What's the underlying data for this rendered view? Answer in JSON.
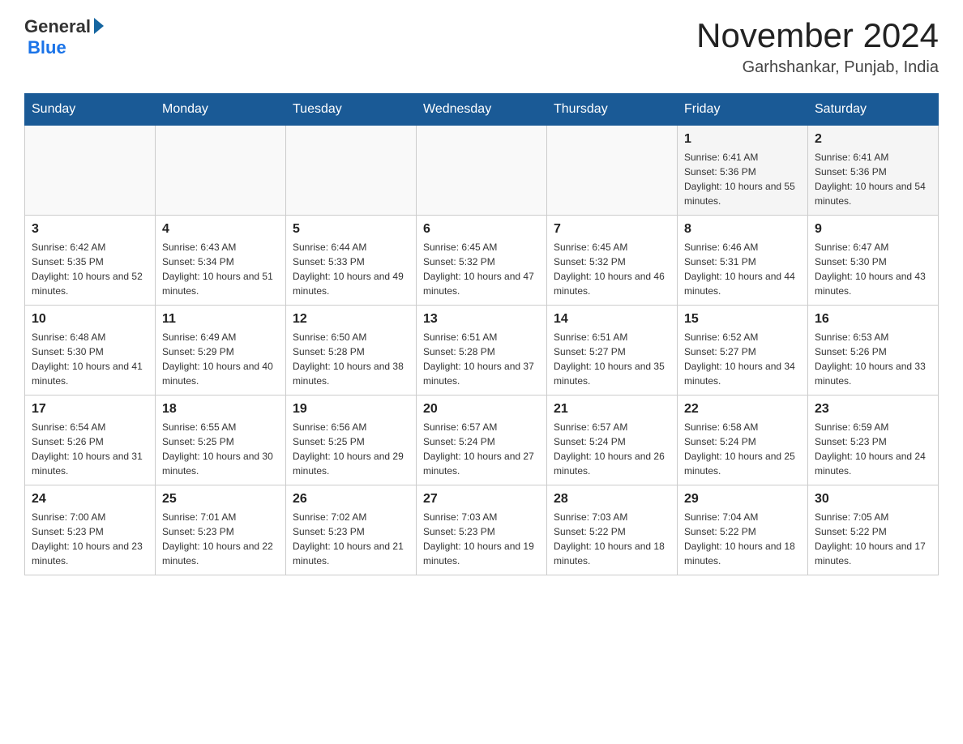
{
  "header": {
    "logo_text": "General",
    "logo_blue": "Blue",
    "main_title": "November 2024",
    "subtitle": "Garhshankar, Punjab, India"
  },
  "weekdays": [
    "Sunday",
    "Monday",
    "Tuesday",
    "Wednesday",
    "Thursday",
    "Friday",
    "Saturday"
  ],
  "weeks": [
    [
      {
        "day": "",
        "info": ""
      },
      {
        "day": "",
        "info": ""
      },
      {
        "day": "",
        "info": ""
      },
      {
        "day": "",
        "info": ""
      },
      {
        "day": "",
        "info": ""
      },
      {
        "day": "1",
        "info": "Sunrise: 6:41 AM\nSunset: 5:36 PM\nDaylight: 10 hours and 55 minutes."
      },
      {
        "day": "2",
        "info": "Sunrise: 6:41 AM\nSunset: 5:36 PM\nDaylight: 10 hours and 54 minutes."
      }
    ],
    [
      {
        "day": "3",
        "info": "Sunrise: 6:42 AM\nSunset: 5:35 PM\nDaylight: 10 hours and 52 minutes."
      },
      {
        "day": "4",
        "info": "Sunrise: 6:43 AM\nSunset: 5:34 PM\nDaylight: 10 hours and 51 minutes."
      },
      {
        "day": "5",
        "info": "Sunrise: 6:44 AM\nSunset: 5:33 PM\nDaylight: 10 hours and 49 minutes."
      },
      {
        "day": "6",
        "info": "Sunrise: 6:45 AM\nSunset: 5:32 PM\nDaylight: 10 hours and 47 minutes."
      },
      {
        "day": "7",
        "info": "Sunrise: 6:45 AM\nSunset: 5:32 PM\nDaylight: 10 hours and 46 minutes."
      },
      {
        "day": "8",
        "info": "Sunrise: 6:46 AM\nSunset: 5:31 PM\nDaylight: 10 hours and 44 minutes."
      },
      {
        "day": "9",
        "info": "Sunrise: 6:47 AM\nSunset: 5:30 PM\nDaylight: 10 hours and 43 minutes."
      }
    ],
    [
      {
        "day": "10",
        "info": "Sunrise: 6:48 AM\nSunset: 5:30 PM\nDaylight: 10 hours and 41 minutes."
      },
      {
        "day": "11",
        "info": "Sunrise: 6:49 AM\nSunset: 5:29 PM\nDaylight: 10 hours and 40 minutes."
      },
      {
        "day": "12",
        "info": "Sunrise: 6:50 AM\nSunset: 5:28 PM\nDaylight: 10 hours and 38 minutes."
      },
      {
        "day": "13",
        "info": "Sunrise: 6:51 AM\nSunset: 5:28 PM\nDaylight: 10 hours and 37 minutes."
      },
      {
        "day": "14",
        "info": "Sunrise: 6:51 AM\nSunset: 5:27 PM\nDaylight: 10 hours and 35 minutes."
      },
      {
        "day": "15",
        "info": "Sunrise: 6:52 AM\nSunset: 5:27 PM\nDaylight: 10 hours and 34 minutes."
      },
      {
        "day": "16",
        "info": "Sunrise: 6:53 AM\nSunset: 5:26 PM\nDaylight: 10 hours and 33 minutes."
      }
    ],
    [
      {
        "day": "17",
        "info": "Sunrise: 6:54 AM\nSunset: 5:26 PM\nDaylight: 10 hours and 31 minutes."
      },
      {
        "day": "18",
        "info": "Sunrise: 6:55 AM\nSunset: 5:25 PM\nDaylight: 10 hours and 30 minutes."
      },
      {
        "day": "19",
        "info": "Sunrise: 6:56 AM\nSunset: 5:25 PM\nDaylight: 10 hours and 29 minutes."
      },
      {
        "day": "20",
        "info": "Sunrise: 6:57 AM\nSunset: 5:24 PM\nDaylight: 10 hours and 27 minutes."
      },
      {
        "day": "21",
        "info": "Sunrise: 6:57 AM\nSunset: 5:24 PM\nDaylight: 10 hours and 26 minutes."
      },
      {
        "day": "22",
        "info": "Sunrise: 6:58 AM\nSunset: 5:24 PM\nDaylight: 10 hours and 25 minutes."
      },
      {
        "day": "23",
        "info": "Sunrise: 6:59 AM\nSunset: 5:23 PM\nDaylight: 10 hours and 24 minutes."
      }
    ],
    [
      {
        "day": "24",
        "info": "Sunrise: 7:00 AM\nSunset: 5:23 PM\nDaylight: 10 hours and 23 minutes."
      },
      {
        "day": "25",
        "info": "Sunrise: 7:01 AM\nSunset: 5:23 PM\nDaylight: 10 hours and 22 minutes."
      },
      {
        "day": "26",
        "info": "Sunrise: 7:02 AM\nSunset: 5:23 PM\nDaylight: 10 hours and 21 minutes."
      },
      {
        "day": "27",
        "info": "Sunrise: 7:03 AM\nSunset: 5:23 PM\nDaylight: 10 hours and 19 minutes."
      },
      {
        "day": "28",
        "info": "Sunrise: 7:03 AM\nSunset: 5:22 PM\nDaylight: 10 hours and 18 minutes."
      },
      {
        "day": "29",
        "info": "Sunrise: 7:04 AM\nSunset: 5:22 PM\nDaylight: 10 hours and 18 minutes."
      },
      {
        "day": "30",
        "info": "Sunrise: 7:05 AM\nSunset: 5:22 PM\nDaylight: 10 hours and 17 minutes."
      }
    ]
  ]
}
